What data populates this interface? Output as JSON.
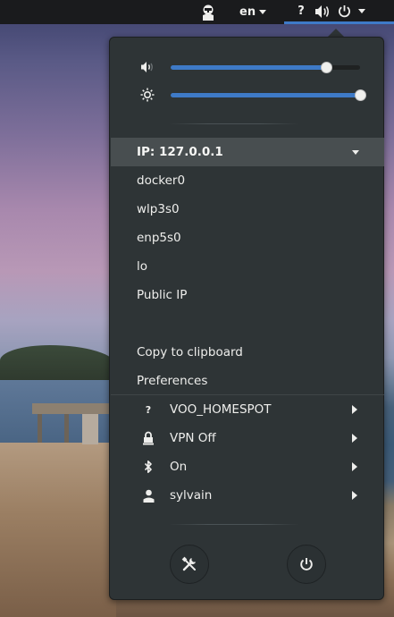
{
  "topbar": {
    "language": "en",
    "help_glyph": "?",
    "icons": [
      "user-icon",
      "volume-icon",
      "power-icon"
    ],
    "accent_color": "#3e7ac7"
  },
  "sliders": {
    "volume": {
      "icon": "volume-low-icon",
      "level": 0.82
    },
    "brightness": {
      "icon": "brightness-icon",
      "level": 1.0
    }
  },
  "network": {
    "header": "IP: 127.0.0.1",
    "interfaces": [
      "docker0",
      "wlp3s0",
      "enp5s0",
      "lo",
      "Public IP"
    ],
    "copy_label": "Copy to clipboard",
    "preferences_label": "Preferences"
  },
  "system_items": [
    {
      "icon": "wifi-unknown-icon",
      "label": "VOO_HOMESPOT"
    },
    {
      "icon": "vpn-lock-icon",
      "label": "VPN Off"
    },
    {
      "icon": "bluetooth-icon",
      "label": "On"
    },
    {
      "icon": "user-icon",
      "label": "sylvain"
    }
  ],
  "bottom_buttons": [
    "settings-icon",
    "power-icon"
  ],
  "wifi_glyph": "?"
}
